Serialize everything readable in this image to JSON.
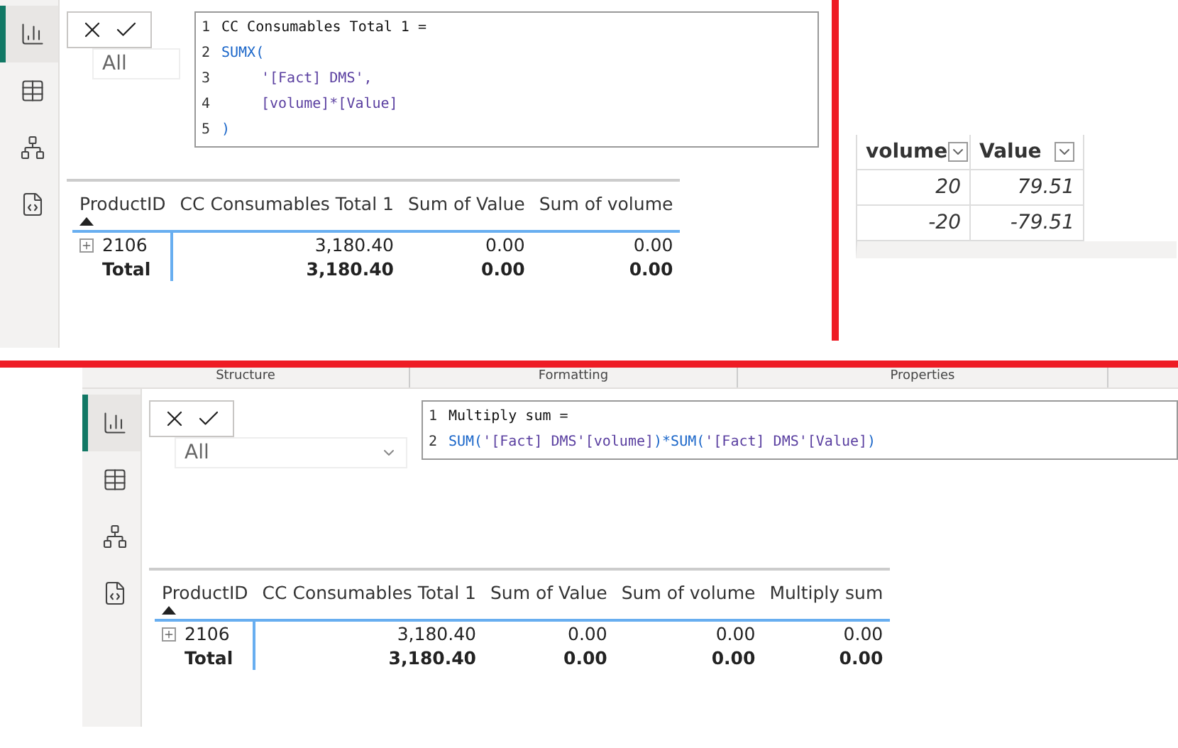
{
  "top_panel": {
    "sidebar": {
      "items": [
        {
          "kind": "report",
          "selected": true
        },
        {
          "kind": "data",
          "selected": false
        },
        {
          "kind": "model",
          "selected": false
        },
        {
          "kind": "dax",
          "selected": false
        }
      ]
    },
    "formula_editor": {
      "lines": [
        {
          "number": "1",
          "indented": false,
          "tokens": [
            {
              "kind": "plain",
              "text": "CC Consumables Total 1 ="
            }
          ]
        },
        {
          "number": "2",
          "indented": false,
          "tokens": [
            {
              "kind": "function",
              "text": "SUMX("
            }
          ]
        },
        {
          "number": "3",
          "indented": true,
          "tokens": [
            {
              "kind": "name",
              "text": "'[Fact] DMS',"
            }
          ]
        },
        {
          "number": "4",
          "indented": true,
          "tokens": [
            {
              "kind": "name",
              "text": "[volume]*[Value]"
            }
          ]
        },
        {
          "number": "5",
          "indented": false,
          "tokens": [
            {
              "kind": "function",
              "text": ")"
            }
          ]
        }
      ]
    },
    "filter": {
      "value": "All"
    },
    "table": {
      "columns": [
        {
          "label": "ProductID",
          "sorted": true
        },
        {
          "label": "CC Consumables Total 1",
          "sorted": false
        },
        {
          "label": "Sum of Value",
          "sorted": false
        },
        {
          "label": "Sum of volume",
          "sorted": false
        }
      ],
      "rows": [
        {
          "total": false,
          "expandable": true,
          "cells": [
            "2106",
            "3,180.40",
            "0.00",
            "0.00"
          ]
        },
        {
          "total": true,
          "expandable": false,
          "cells": [
            "Total",
            "3,180.40",
            "0.00",
            "0.00"
          ]
        }
      ]
    }
  },
  "data_view": {
    "columns": [
      "volume",
      "Value"
    ],
    "rows": [
      [
        "20",
        "79.51"
      ],
      [
        "-20",
        "-79.51"
      ]
    ]
  },
  "bottom_panel": {
    "ribbon": [
      "Structure",
      "Formatting",
      "Properties"
    ],
    "sidebar": {
      "items": [
        {
          "kind": "report",
          "selected": true
        },
        {
          "kind": "data",
          "selected": false
        },
        {
          "kind": "model",
          "selected": false
        },
        {
          "kind": "dax",
          "selected": false
        }
      ]
    },
    "formula_editor": {
      "lines": [
        {
          "number": "1",
          "indented": false,
          "tokens": [
            {
              "kind": "plain",
              "text": "Multiply sum ="
            }
          ]
        },
        {
          "number": "2",
          "indented": false,
          "tokens": [
            {
              "kind": "function",
              "text": "SUM("
            },
            {
              "kind": "name",
              "text": "'[Fact] DMS'[volume]"
            },
            {
              "kind": "function",
              "text": ")*SUM("
            },
            {
              "kind": "name",
              "text": "'[Fact] DMS'[Value]"
            },
            {
              "kind": "function",
              "text": ")"
            }
          ]
        }
      ]
    },
    "filter": {
      "value": "All"
    },
    "table": {
      "columns": [
        {
          "label": "ProductID",
          "sorted": true
        },
        {
          "label": "CC Consumables Total 1",
          "sorted": false
        },
        {
          "label": "Sum of Value",
          "sorted": false
        },
        {
          "label": "Sum of volume",
          "sorted": false
        },
        {
          "label": "Multiply sum",
          "sorted": false
        }
      ],
      "rows": [
        {
          "total": false,
          "expandable": true,
          "cells": [
            "2106",
            "3,180.40",
            "0.00",
            "0.00",
            "0.00"
          ]
        },
        {
          "total": true,
          "expandable": false,
          "cells": [
            "Total",
            "3,180.40",
            "0.00",
            "0.00",
            "0.00"
          ]
        }
      ]
    }
  }
}
